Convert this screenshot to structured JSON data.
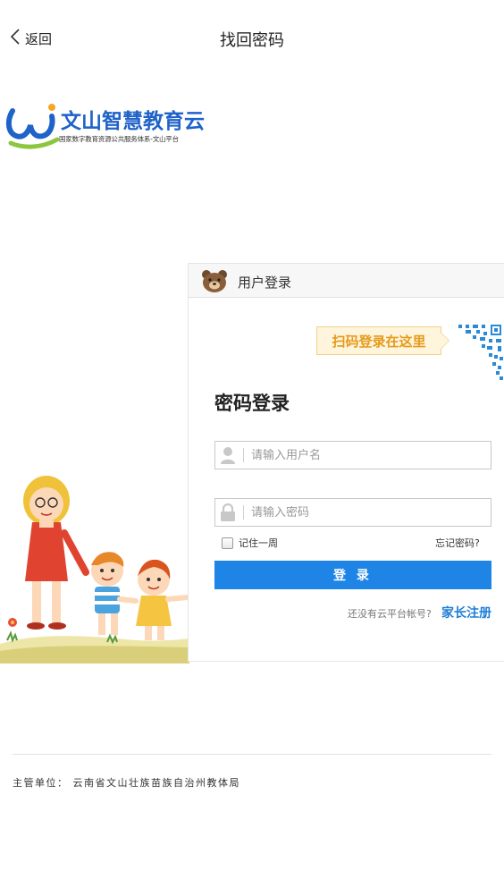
{
  "header": {
    "back_label": "返回",
    "title": "找回密码"
  },
  "logo": {
    "title": "文山智慧教育云",
    "subtitle": "国家数字教育资源公共服务体系-文山平台"
  },
  "login_panel": {
    "header_label": "用户登录",
    "qr_tip": "扫码登录在这里",
    "section_title": "密码登录",
    "username_placeholder": "请输入用户名",
    "password_placeholder": "请输入密码",
    "remember_label": "记住一周",
    "forgot_label": "忘记密码?",
    "login_button": "登 录",
    "no_account_text": "还没有云平台帐号?",
    "register_link": "家长注册"
  },
  "footer": {
    "text": "主管单位：  云南省文山壮族苗族自治州教体局"
  },
  "colors": {
    "accent": "#1e84e6",
    "qr_tip_text": "#e59b1c",
    "logo_blue": "#1f62c8"
  },
  "icons": [
    "chevron-left-icon",
    "bear-icon",
    "qr-code-icon",
    "user-icon",
    "lock-icon"
  ]
}
